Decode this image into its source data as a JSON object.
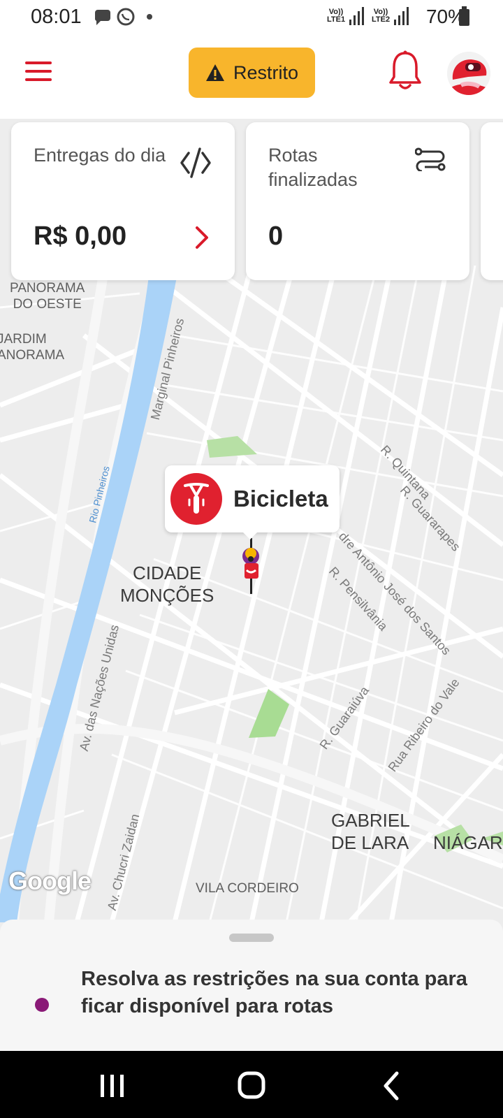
{
  "status_bar": {
    "time": "08:01",
    "sim1_label": "Vo))\nLTE1",
    "sim2_label": "Vo))\nLTE2",
    "battery": "70%"
  },
  "header": {
    "status_chip_label": "Restrito",
    "colors": {
      "accent": "#d91a2a",
      "chip": "#f8b52c"
    }
  },
  "cards": [
    {
      "title": "Entregas do dia",
      "value": "R$ 0,00",
      "icon": "eye-off-icon"
    },
    {
      "title": "Rotas finalizadas",
      "value": "0",
      "icon": "route-icon"
    }
  ],
  "map": {
    "labels": {
      "jardim_panorama_oeste": "JARDIM\nPANORAMA\nDO OESTE",
      "jardim_panorama": "JARDIM\nANORAMA",
      "cidade_moncoes": "CIDADE\nMONÇÕES",
      "gabriel_de_lara": "GABRIEL\nDE LARA",
      "niagara": "NIÁGAR",
      "vila_cordeiro": "VILA CORDEIRO"
    },
    "streets": {
      "marginal_pinheiros": "Marginal Pinheiros",
      "rio_pinheiros": "Rio Pinheiros",
      "r_quintana": "R. Quintana",
      "r_guararapes": "R. Guararapes",
      "antonio_jose_santos": "dre Antônio José dos Santos",
      "r_pensilvania": "R. Pensilvânia",
      "av_nacoes_unidas": "Av. das Nações Unidas",
      "r_guaraiuva": "R. Guaraiúva",
      "rua_ribeiro_vale": "Rua Ribeiro do Vale",
      "av_chucri_zaidan": "Av. Chucri Zaidan"
    },
    "attribution": "Google",
    "vehicle_label": "Bicicleta"
  },
  "sheet": {
    "message": "Resolva as restrições na sua conta para ficar disponível para rotas"
  }
}
